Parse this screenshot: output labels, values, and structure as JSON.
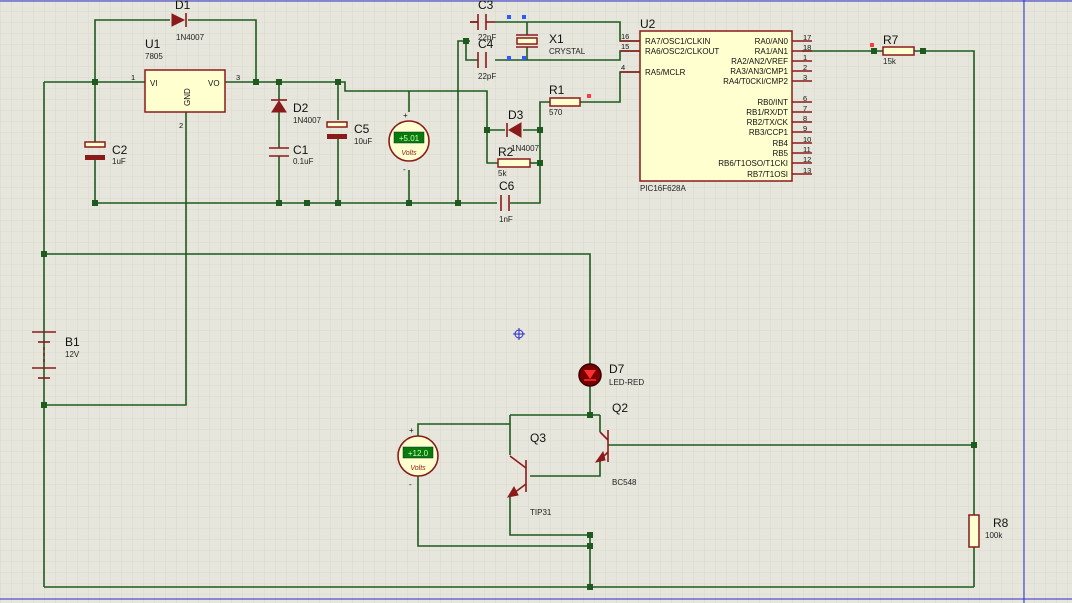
{
  "colors": {
    "background": "#e6e6dc",
    "grid": "#cfcfc2",
    "wire": "#1e5a1e",
    "component": "#8b1a1a",
    "body_fill": "#ffffd0",
    "border": "#2b2bcc"
  },
  "components": {
    "U1": {
      "ref": "U1",
      "value": "7805",
      "pin_vi": "VI",
      "pin_vo": "VO",
      "pin_gnd": "GND",
      "pin1": "1",
      "pin2": "2",
      "pin3": "3"
    },
    "D1": {
      "ref": "D1",
      "value": "1N4007"
    },
    "D2": {
      "ref": "D2",
      "value": "1N4007"
    },
    "D3": {
      "ref": "D3",
      "value": "1N4007"
    },
    "C1": {
      "ref": "C1",
      "value": "0.1uF"
    },
    "C2": {
      "ref": "C2",
      "value": "1uF"
    },
    "C3": {
      "ref": "C3",
      "value": "22pF"
    },
    "C4": {
      "ref": "C4",
      "value": "22pF"
    },
    "C5": {
      "ref": "C5",
      "value": "10uF"
    },
    "C6": {
      "ref": "C6",
      "value": "1nF"
    },
    "X1": {
      "ref": "X1",
      "value": "CRYSTAL"
    },
    "R1": {
      "ref": "R1",
      "value": "570"
    },
    "R2": {
      "ref": "R2",
      "value": "5k"
    },
    "R7": {
      "ref": "R7",
      "value": "15k"
    },
    "R8": {
      "ref": "R8",
      "value": "100k"
    },
    "B1": {
      "ref": "B1",
      "value": "12V"
    },
    "D7": {
      "ref": "D7",
      "value": "LED-RED"
    },
    "Q2": {
      "ref": "Q2",
      "value": "BC548"
    },
    "Q3": {
      "ref": "Q3",
      "value": "TIP31"
    },
    "U2": {
      "ref": "U2",
      "value": "PIC16F628A",
      "left_pins": [
        {
          "name": "RA7/OSC1/CLKIN",
          "num": "16"
        },
        {
          "name": "RA6/OSC2/CLKOUT",
          "num": "15"
        },
        {
          "name": "RA5/MCLR",
          "num": "4"
        }
      ],
      "right_pins": [
        {
          "name": "RA0/AN0",
          "num": "17"
        },
        {
          "name": "RA1/AN1",
          "num": "18"
        },
        {
          "name": "RA2/AN2/VREF",
          "num": "1"
        },
        {
          "name": "RA3/AN3/CMP1",
          "num": "2"
        },
        {
          "name": "RA4/T0CKI/CMP2",
          "num": "3"
        },
        {
          "name": "RB0/INT",
          "num": "6"
        },
        {
          "name": "RB1/RX/DT",
          "num": "7"
        },
        {
          "name": "RB2/TX/CK",
          "num": "8"
        },
        {
          "name": "RB3/CCP1",
          "num": "9"
        },
        {
          "name": "RB4",
          "num": "10"
        },
        {
          "name": "RB5",
          "num": "11"
        },
        {
          "name": "RB6/T1OSO/T1CKI",
          "num": "12"
        },
        {
          "name": "RB7/T1OSI",
          "num": "13"
        }
      ]
    }
  },
  "voltmeters": [
    {
      "reading": "+5.01",
      "unit": "Volts",
      "plus": "+",
      "minus": "-"
    },
    {
      "reading": "+12.0",
      "unit": "Volts",
      "plus": "+",
      "minus": "-"
    }
  ]
}
